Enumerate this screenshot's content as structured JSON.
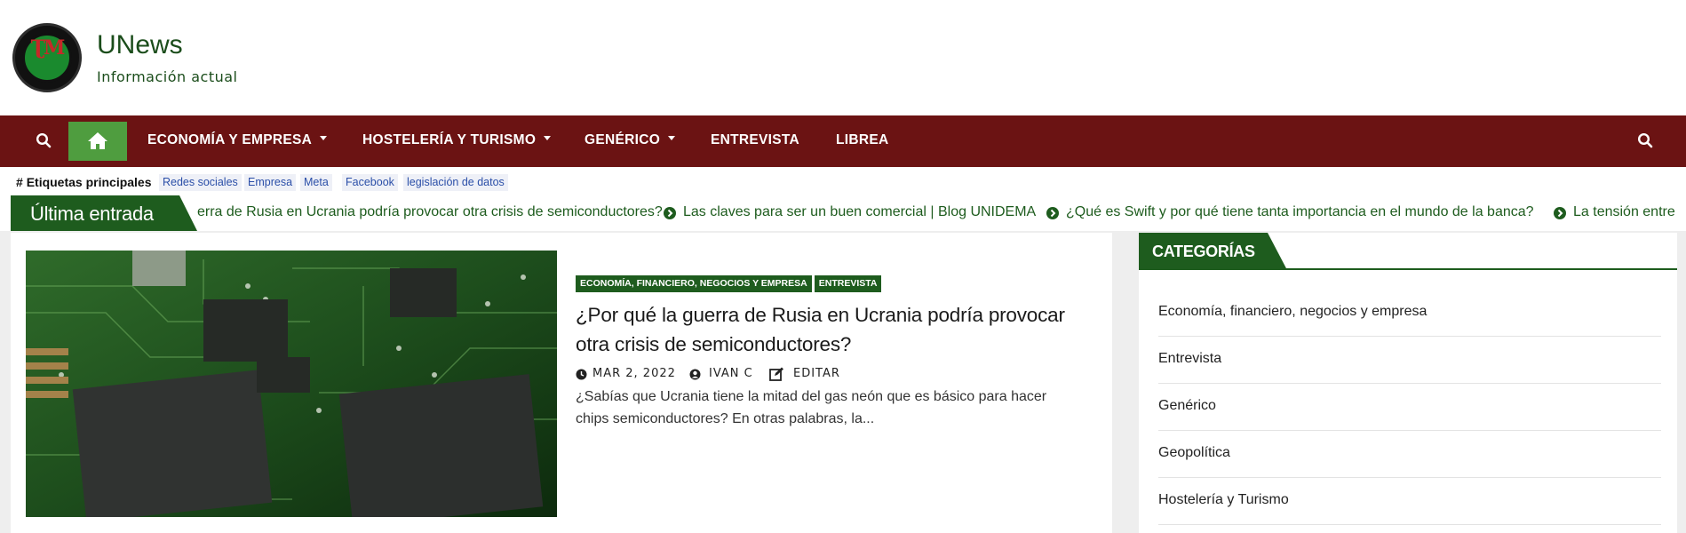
{
  "header": {
    "site_title": "UNews",
    "tagline": "Información actual"
  },
  "nav": {
    "items": [
      {
        "label": "ECONOMÍA Y EMPRESA",
        "dropdown": true
      },
      {
        "label": "HOSTELERÍA Y TURISMO",
        "dropdown": true
      },
      {
        "label": "GENÉRICO",
        "dropdown": true
      },
      {
        "label": "ENTREVISTA",
        "dropdown": false
      },
      {
        "label": "LIBREA",
        "dropdown": false
      }
    ],
    "colors": {
      "bar": "#6b1313",
      "home": "#4f9d3f"
    }
  },
  "tags": {
    "title": "Etiquetas principales",
    "items": [
      "Redes sociales",
      "Empresa",
      "Meta",
      "Facebook",
      "legislación de datos"
    ]
  },
  "ticker": {
    "label": "Última entrada",
    "items": [
      "erra de Rusia en Ucrania podría provocar otra crisis de semiconductores?",
      "Las claves para ser un buen comercial | Blog UNIDEMA",
      "¿Qué es Swift y por qué tiene tanta importancia en el mundo de la banca?",
      "La tensión entre"
    ]
  },
  "post": {
    "categories": [
      "ECONOMÍA, FINANCIERO, NEGOCIOS Y EMPRESA",
      "ENTREVISTA"
    ],
    "title": "¿Por qué la guerra de Rusia en Ucrania podría provocar otra crisis de semiconductores?",
    "date": "MAR 2, 2022",
    "author": "IVAN C",
    "edit_label": "EDITAR",
    "excerpt": "¿Sabías que Ucrania tiene la mitad del gas neón que es básico para hacer chips semiconductores? En otras palabras, la..."
  },
  "sidebar": {
    "heading": "CATEGORÍAS",
    "categories": [
      "Economía, financiero, negocios y empresa",
      "Entrevista",
      "Genérico",
      "Geopolítica",
      "Hostelería y Turismo"
    ]
  },
  "colors": {
    "accent_green": "#1e5c1e",
    "brand_dark_red": "#6b1313"
  }
}
